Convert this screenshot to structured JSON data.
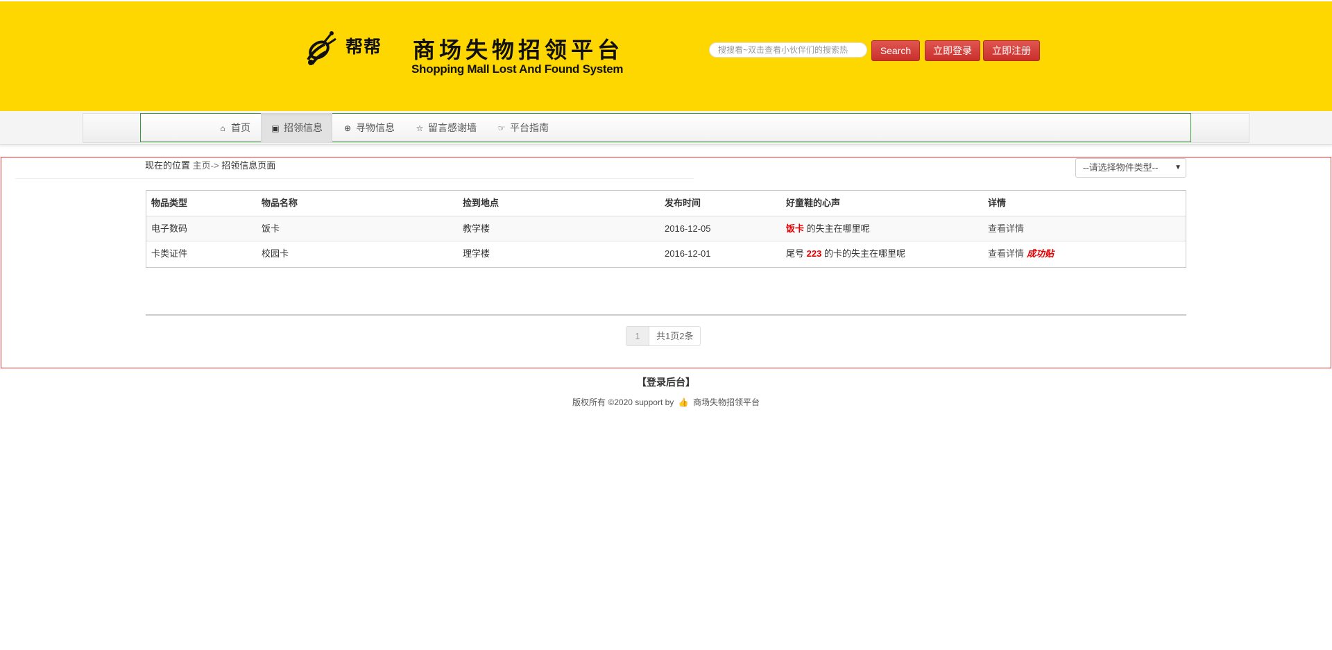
{
  "header": {
    "logo_text": "帮帮",
    "site_title": "商场失物招领平台",
    "site_subtitle": "Shopping Mall Lost And Found System",
    "search_placeholder": "搜搜看~双击查看小伙伴们的搜索热",
    "search_button": "Search",
    "login_button": "立即登录",
    "register_button": "立即注册",
    "background_color": "#ffd700"
  },
  "nav": {
    "items": [
      {
        "label": "首页",
        "icon": "home-icon",
        "active": false
      },
      {
        "label": "招领信息",
        "icon": "picture-icon",
        "active": true
      },
      {
        "label": "寻物信息",
        "icon": "zoom-in-icon",
        "active": false
      },
      {
        "label": "留言感谢墙",
        "icon": "star-empty-icon",
        "active": false
      },
      {
        "label": "平台指南",
        "icon": "hand-right-icon",
        "active": false
      }
    ]
  },
  "breadcrumb": {
    "prefix": "现在的位置",
    "home": "主页->",
    "current": "招领信息页面"
  },
  "filter": {
    "selected": "--请选择物件类型--"
  },
  "table": {
    "headers": [
      "物品类型",
      "物品名称",
      "捡到地点",
      "发布时间",
      "好童鞋的心声",
      "详情"
    ],
    "rows": [
      {
        "type": "电子数码",
        "name": "饭卡",
        "location": "教学楼",
        "date": "2016-12-05",
        "message_highlight": "饭卡",
        "message_rest": " 的失主在哪里呢",
        "detail": "查看详情",
        "badge": ""
      },
      {
        "type": "卡类证件",
        "name": "校园卡",
        "location": "理学楼",
        "date": "2016-12-01",
        "message_prefix": "尾号 ",
        "message_highlight": "223",
        "message_rest": " 的卡的失主在哪里呢",
        "detail": "查看详情",
        "badge": "成功贴"
      }
    ]
  },
  "pagination": {
    "current_page": "1",
    "summary": "共1页2条"
  },
  "footer": {
    "admin_login": "【登录后台】",
    "copyright_prefix": "版权所有 ©2020 support by",
    "copyright_suffix": "商场失物招领平台"
  }
}
